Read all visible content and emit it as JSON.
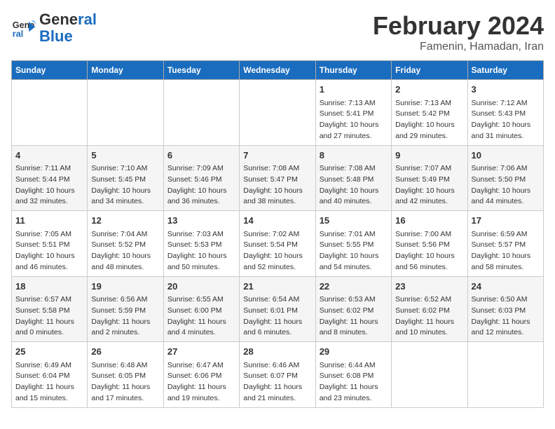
{
  "header": {
    "logo_general": "General",
    "logo_blue": "Blue",
    "title": "February 2024",
    "subtitle": "Famenin, Hamadan, Iran"
  },
  "weekdays": [
    "Sunday",
    "Monday",
    "Tuesday",
    "Wednesday",
    "Thursday",
    "Friday",
    "Saturday"
  ],
  "weeks": [
    [
      {
        "day": "",
        "info": ""
      },
      {
        "day": "",
        "info": ""
      },
      {
        "day": "",
        "info": ""
      },
      {
        "day": "",
        "info": ""
      },
      {
        "day": "1",
        "info": "Sunrise: 7:13 AM\nSunset: 5:41 PM\nDaylight: 10 hours\nand 27 minutes."
      },
      {
        "day": "2",
        "info": "Sunrise: 7:13 AM\nSunset: 5:42 PM\nDaylight: 10 hours\nand 29 minutes."
      },
      {
        "day": "3",
        "info": "Sunrise: 7:12 AM\nSunset: 5:43 PM\nDaylight: 10 hours\nand 31 minutes."
      }
    ],
    [
      {
        "day": "4",
        "info": "Sunrise: 7:11 AM\nSunset: 5:44 PM\nDaylight: 10 hours\nand 32 minutes."
      },
      {
        "day": "5",
        "info": "Sunrise: 7:10 AM\nSunset: 5:45 PM\nDaylight: 10 hours\nand 34 minutes."
      },
      {
        "day": "6",
        "info": "Sunrise: 7:09 AM\nSunset: 5:46 PM\nDaylight: 10 hours\nand 36 minutes."
      },
      {
        "day": "7",
        "info": "Sunrise: 7:08 AM\nSunset: 5:47 PM\nDaylight: 10 hours\nand 38 minutes."
      },
      {
        "day": "8",
        "info": "Sunrise: 7:08 AM\nSunset: 5:48 PM\nDaylight: 10 hours\nand 40 minutes."
      },
      {
        "day": "9",
        "info": "Sunrise: 7:07 AM\nSunset: 5:49 PM\nDaylight: 10 hours\nand 42 minutes."
      },
      {
        "day": "10",
        "info": "Sunrise: 7:06 AM\nSunset: 5:50 PM\nDaylight: 10 hours\nand 44 minutes."
      }
    ],
    [
      {
        "day": "11",
        "info": "Sunrise: 7:05 AM\nSunset: 5:51 PM\nDaylight: 10 hours\nand 46 minutes."
      },
      {
        "day": "12",
        "info": "Sunrise: 7:04 AM\nSunset: 5:52 PM\nDaylight: 10 hours\nand 48 minutes."
      },
      {
        "day": "13",
        "info": "Sunrise: 7:03 AM\nSunset: 5:53 PM\nDaylight: 10 hours\nand 50 minutes."
      },
      {
        "day": "14",
        "info": "Sunrise: 7:02 AM\nSunset: 5:54 PM\nDaylight: 10 hours\nand 52 minutes."
      },
      {
        "day": "15",
        "info": "Sunrise: 7:01 AM\nSunset: 5:55 PM\nDaylight: 10 hours\nand 54 minutes."
      },
      {
        "day": "16",
        "info": "Sunrise: 7:00 AM\nSunset: 5:56 PM\nDaylight: 10 hours\nand 56 minutes."
      },
      {
        "day": "17",
        "info": "Sunrise: 6:59 AM\nSunset: 5:57 PM\nDaylight: 10 hours\nand 58 minutes."
      }
    ],
    [
      {
        "day": "18",
        "info": "Sunrise: 6:57 AM\nSunset: 5:58 PM\nDaylight: 11 hours\nand 0 minutes."
      },
      {
        "day": "19",
        "info": "Sunrise: 6:56 AM\nSunset: 5:59 PM\nDaylight: 11 hours\nand 2 minutes."
      },
      {
        "day": "20",
        "info": "Sunrise: 6:55 AM\nSunset: 6:00 PM\nDaylight: 11 hours\nand 4 minutes."
      },
      {
        "day": "21",
        "info": "Sunrise: 6:54 AM\nSunset: 6:01 PM\nDaylight: 11 hours\nand 6 minutes."
      },
      {
        "day": "22",
        "info": "Sunrise: 6:53 AM\nSunset: 6:02 PM\nDaylight: 11 hours\nand 8 minutes."
      },
      {
        "day": "23",
        "info": "Sunrise: 6:52 AM\nSunset: 6:02 PM\nDaylight: 11 hours\nand 10 minutes."
      },
      {
        "day": "24",
        "info": "Sunrise: 6:50 AM\nSunset: 6:03 PM\nDaylight: 11 hours\nand 12 minutes."
      }
    ],
    [
      {
        "day": "25",
        "info": "Sunrise: 6:49 AM\nSunset: 6:04 PM\nDaylight: 11 hours\nand 15 minutes."
      },
      {
        "day": "26",
        "info": "Sunrise: 6:48 AM\nSunset: 6:05 PM\nDaylight: 11 hours\nand 17 minutes."
      },
      {
        "day": "27",
        "info": "Sunrise: 6:47 AM\nSunset: 6:06 PM\nDaylight: 11 hours\nand 19 minutes."
      },
      {
        "day": "28",
        "info": "Sunrise: 6:46 AM\nSunset: 6:07 PM\nDaylight: 11 hours\nand 21 minutes."
      },
      {
        "day": "29",
        "info": "Sunrise: 6:44 AM\nSunset: 6:08 PM\nDaylight: 11 hours\nand 23 minutes."
      },
      {
        "day": "",
        "info": ""
      },
      {
        "day": "",
        "info": ""
      }
    ]
  ]
}
